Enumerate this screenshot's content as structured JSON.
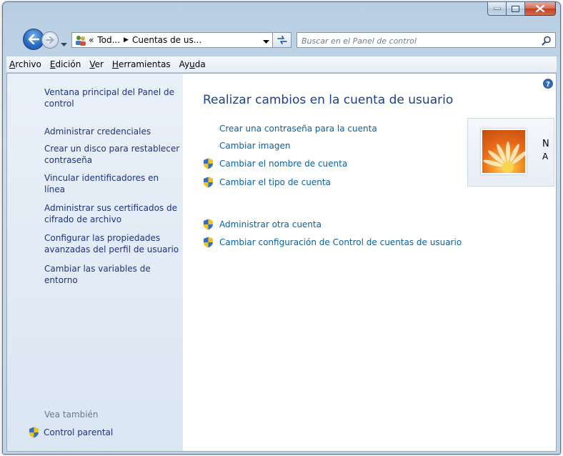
{
  "window": {
    "controls": {
      "minimize": "minimize",
      "maximize": "maximize",
      "close": "close"
    }
  },
  "navigation": {
    "address_prefix": "«",
    "crumbs": [
      "Tod...",
      "Cuentas de us..."
    ],
    "search_placeholder": "Buscar en el Panel de control"
  },
  "menu": {
    "items": [
      "Archivo",
      "Edición",
      "Ver",
      "Herramientas",
      "Ayuda"
    ]
  },
  "sidebar": {
    "items": [
      "Ventana principal del Panel de control",
      "Administrar credenciales",
      "Crear un disco para restablecer contraseña",
      "Vincular identificadores en línea",
      "Administrar sus certificados de cifrado de archivo",
      "Configurar las propiedades avanzadas del perfil de usuario",
      "Cambiar las variables de entorno"
    ],
    "see_also_label": "Vea también",
    "see_also_items": [
      "Control parental"
    ]
  },
  "main": {
    "title": "Realizar cambios en la cuenta de usuario",
    "links": [
      "Crear una contraseña para la cuenta",
      "Cambiar imagen",
      "Cambiar el nombre de cuenta",
      "Cambiar el tipo de cuenta",
      "Administrar otra cuenta",
      "Cambiar configuración de Control de cuentas de usuario"
    ]
  },
  "account": {
    "name_initial": "N",
    "type_initial": "A"
  },
  "icons": {
    "back": "back-arrow-icon",
    "forward": "forward-arrow-icon",
    "users": "users-icon",
    "refresh": "refresh-icon",
    "search": "search-icon",
    "help": "help-icon",
    "shield": "uac-shield-icon"
  },
  "colors": {
    "link": "#0b5fa6",
    "task_link": "#1e3287",
    "title": "#1e3f8a",
    "close_button": "#c2401f"
  }
}
